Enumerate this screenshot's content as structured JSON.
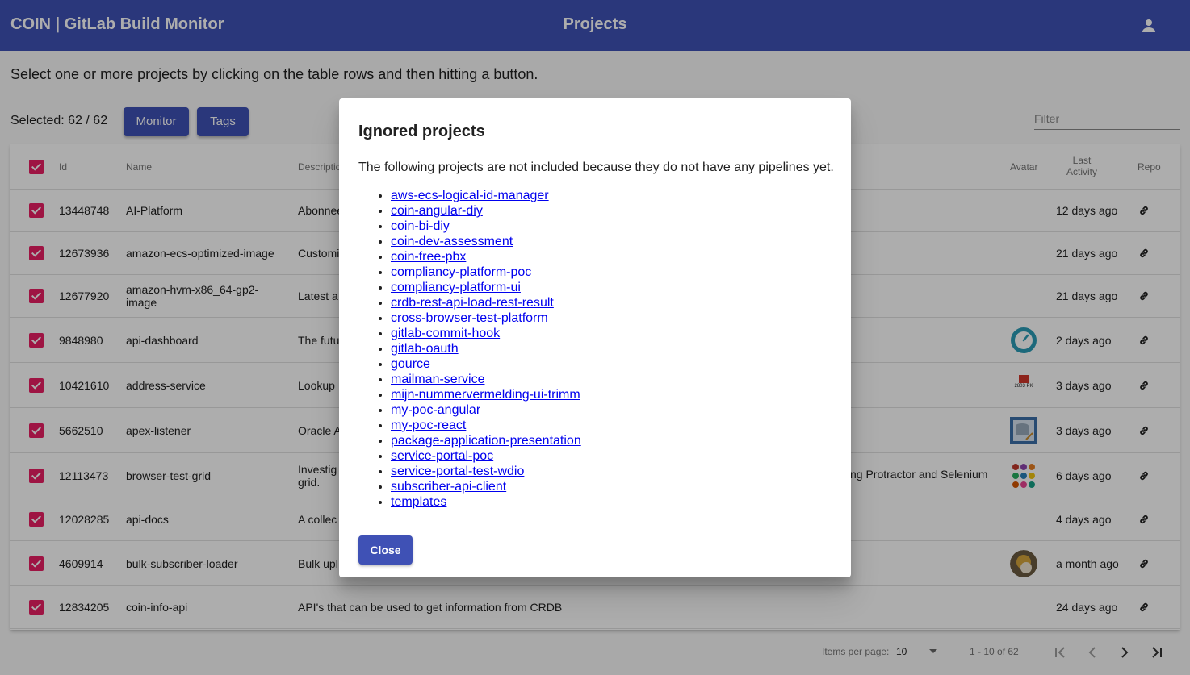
{
  "header": {
    "app_title": "COIN | GitLab Build Monitor",
    "page_title": "Projects",
    "user_icon": "account-icon"
  },
  "intro_text": "Select one or more projects by clicking on the table rows and then hitting a button.",
  "selection": {
    "selected_text": "Selected: 62 / 62",
    "monitor_label": "Monitor",
    "tags_label": "Tags"
  },
  "filter": {
    "placeholder": "Filter",
    "value": ""
  },
  "table": {
    "columns": {
      "id": "Id",
      "name": "Name",
      "description": "Descriptio",
      "avatar": "Avatar",
      "last_activity": "Last Activity",
      "repo": "Repo"
    },
    "rows": [
      {
        "id": "13448748",
        "name": "AI-Platform",
        "description": "Abonnee",
        "avatar": "",
        "last_activity": "12 days ago"
      },
      {
        "id": "12673936",
        "name": "amazon-ecs-optimized-image",
        "description": "Customi",
        "avatar": "",
        "last_activity": "21 days ago"
      },
      {
        "id": "12677920",
        "name": "amazon-hvm-x86_64-gp2-image",
        "description": "Latest a",
        "avatar": "",
        "last_activity": "21 days ago"
      },
      {
        "id": "9848980",
        "name": "api-dashboard",
        "description": "The futu",
        "avatar": "dashboard-gauge-avatar",
        "last_activity": "2 days ago"
      },
      {
        "id": "10421610",
        "name": "address-service",
        "description": "Lookup",
        "avatar": "address-building-avatar",
        "avatar_text": "2803 PK",
        "last_activity": "3 days ago"
      },
      {
        "id": "5662510",
        "name": "apex-listener",
        "description": "Oracle A",
        "avatar": "database-avatar",
        "last_activity": "3 days ago"
      },
      {
        "id": "12113473",
        "name": "browser-test-grid",
        "description": "Investig grid.",
        "description_tail": "ng Protractor and Selenium",
        "avatar": "dots-grid-avatar",
        "last_activity": "6 days ago"
      },
      {
        "id": "12028285",
        "name": "api-docs",
        "description": "A collec",
        "avatar": "",
        "last_activity": "4 days ago"
      },
      {
        "id": "4609914",
        "name": "bulk-subscriber-loader",
        "description": "Bulk upl",
        "avatar": "photo-avatar",
        "last_activity": "a month ago"
      },
      {
        "id": "12834205",
        "name": "coin-info-api",
        "description": "API's that can be used to get information from CRDB",
        "avatar": "",
        "last_activity": "24 days ago"
      }
    ]
  },
  "paginator": {
    "items_per_page_label": "Items per page:",
    "items_per_page": "10",
    "range_label": "1 - 10 of 62"
  },
  "dialog": {
    "title": "Ignored projects",
    "description": "The following projects are not included because they do not have any pipelines yet.",
    "projects": [
      "aws-ecs-logical-id-manager",
      "coin-angular-diy",
      "coin-bi-diy",
      "coin-dev-assessment",
      "coin-free-pbx",
      "compliancy-platform-poc",
      "compliancy-platform-ui",
      "crdb-rest-api-load-rest-result",
      "cross-browser-test-platform",
      "gitlab-commit-hook",
      "gitlab-oauth",
      "gource",
      "mailman-service",
      "mijn-nummervermelding-ui-trimm",
      "my-poc-angular",
      "my-poc-react",
      "package-application-presentation",
      "service-portal-poc",
      "service-portal-test-wdio",
      "subscriber-api-client",
      "templates"
    ],
    "close_label": "Close"
  },
  "colors": {
    "primary": "#3f51b5",
    "checkbox": "#e91e63",
    "link": "#0000ee"
  }
}
